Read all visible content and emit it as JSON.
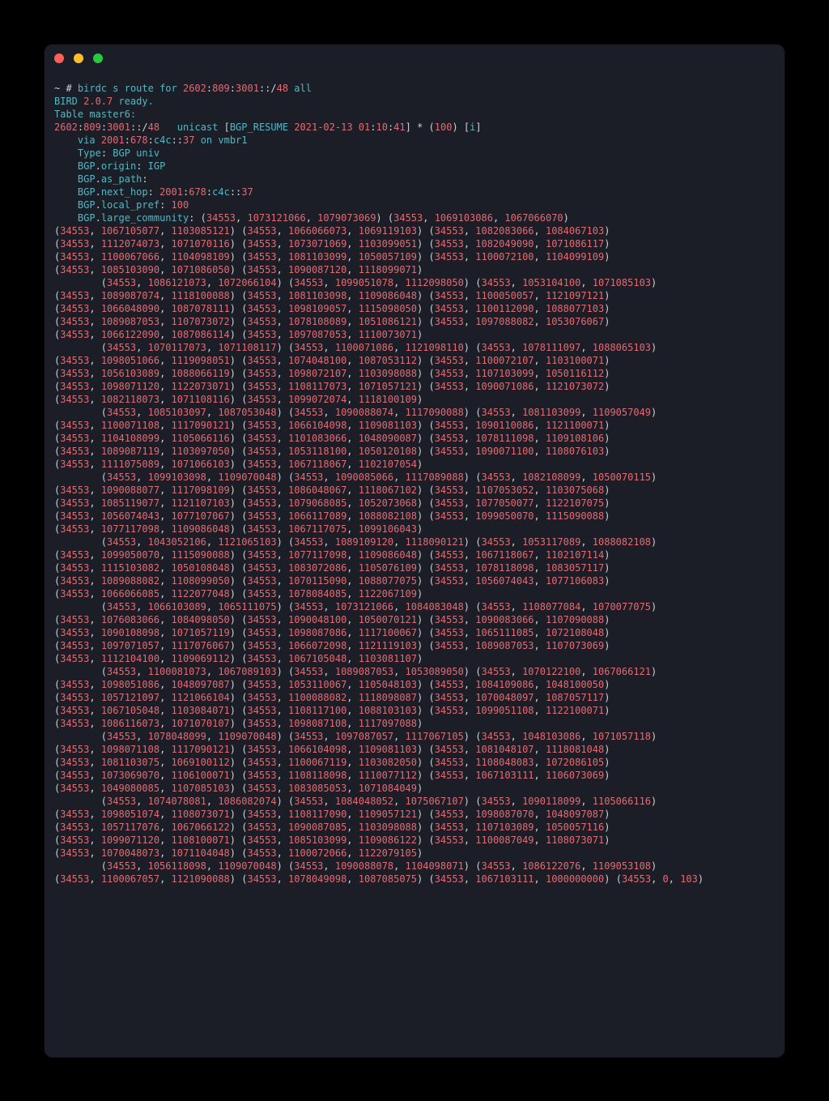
{
  "prompt_prefix": "~ # ",
  "cmd": {
    "w1": "birdc ",
    "w2": "s route ",
    "w3": "for ",
    "addr": "2602",
    "sep1": ":",
    "a2": "809",
    "sep2": ":",
    "a3": "3001",
    "sep3": "::/",
    "pre": "48",
    "tail": " all"
  },
  "line2": {
    "a": "BIRD ",
    "v": "2.0.7",
    "b": " ready."
  },
  "line3": "Table master6:",
  "line4": {
    "p1": "2602",
    "c": ":",
    "p2": "809",
    "p3": "3001",
    "tail": "::/",
    "pre": "48",
    "sp": "   ",
    "uni": "unicast ",
    "lb": "[",
    "name": "BGP_RESUME ",
    "d1": "2021-02-13",
    "sp2": " ",
    "t1": "01",
    "tc": ":",
    "t2": "10",
    "t3": "41",
    "rb": "]",
    "star": " * (",
    "hund": "100",
    "close": ") [",
    "i": "i",
    "end": "]"
  },
  "line5": {
    "a": "    via ",
    "v1": "2001",
    "c": ":",
    "v2": "678",
    "v3": "c4c",
    "v4": "::",
    "v5": "37",
    "on": " on vmbr1"
  },
  "line6": {
    "ind": "    ",
    "t": "Type",
    "colon": ": ",
    "v": "BGP univ"
  },
  "line7": {
    "ind": "    ",
    "b": "BGP",
    ".": ".",
    "k": "origin",
    ":": ": ",
    "v": "IGP"
  },
  "line8": {
    "ind": "    ",
    "b": "BGP",
    ".": ".",
    "k": "as_path",
    ":": ":"
  },
  "line9": {
    "ind": "    ",
    "b": "BGP",
    ".": ".",
    "k": "next_hop",
    ":": ": ",
    "v1": "2001",
    "c": ":",
    "v2": "678",
    "v3": "c4c",
    "v4": "::",
    "v5": "37"
  },
  "line10": {
    "ind": "    ",
    "b": "BGP",
    ".": ".",
    "k": "local_pref",
    ":": ": ",
    "v": "100"
  },
  "line11": {
    "ind": "    ",
    "b": "BGP",
    ".": ".",
    "k": "large_community",
    ":": ": "
  },
  "blocks": [
    {
      "lead_label": true,
      "rows": [
        [
          [
            34553,
            1073121066,
            1079073069
          ],
          [
            34553,
            1069103086,
            1067066070
          ],
          [
            34553,
            1067105077,
            1103085121
          ],
          [
            34553,
            1066066073,
            1069119103
          ],
          [
            34553,
            1082083066,
            1084067103
          ],
          [
            34553,
            1112074073,
            1071070116
          ],
          [
            34553,
            1073071069,
            1103099051
          ],
          [
            34553,
            1082049090,
            1071086117
          ],
          [
            34553,
            1100067066,
            1104098109
          ],
          [
            34553,
            1081103099,
            1050057109
          ],
          [
            34553,
            1100072100,
            1104099109
          ],
          [
            34553,
            1085103090,
            1071086050
          ],
          [
            34553,
            1090087120,
            1118099071
          ]
        ]
      ]
    },
    {
      "rows": [
        [
          [
            34553,
            1086121073,
            1072066104
          ],
          [
            34553,
            1099051078,
            1112098050
          ],
          [
            34553,
            1053104100,
            1071085103
          ],
          [
            34553,
            1089087074,
            1118100088
          ],
          [
            34553,
            1081103098,
            1109086048
          ],
          [
            34553,
            1100050057,
            1121097121
          ],
          [
            34553,
            1066048090,
            1087078111
          ],
          [
            34553,
            1098109057,
            1115098050
          ],
          [
            34553,
            1100112090,
            1088077103
          ],
          [
            34553,
            1089087053,
            1107073072
          ],
          [
            34553,
            1078108089,
            1051086121
          ],
          [
            34553,
            1097088082,
            1053076067
          ],
          [
            34553,
            1066122090,
            1087086114
          ],
          [
            34553,
            1097087053,
            1110073071
          ]
        ]
      ]
    },
    {
      "rows": [
        [
          [
            34553,
            1070117073,
            1071108117
          ],
          [
            34553,
            1100071086,
            1121098110
          ],
          [
            34553,
            1078111097,
            1088065103
          ],
          [
            34553,
            1098051066,
            1119098051
          ],
          [
            34553,
            1074048100,
            1087053112
          ],
          [
            34553,
            1100072107,
            1103100071
          ],
          [
            34553,
            1056103089,
            1088066119
          ],
          [
            34553,
            1098072107,
            1103098088
          ],
          [
            34553,
            1107103099,
            1050116112
          ],
          [
            34553,
            1098071120,
            1122073071
          ],
          [
            34553,
            1108117073,
            1071057121
          ],
          [
            34553,
            1090071086,
            1121073072
          ],
          [
            34553,
            1082118073,
            1071108116
          ],
          [
            34553,
            1099072074,
            1118100109
          ]
        ]
      ]
    },
    {
      "rows": [
        [
          [
            34553,
            1085103097,
            1087053048
          ],
          [
            34553,
            1090088074,
            1117090088
          ],
          [
            34553,
            1081103099,
            1109057049
          ],
          [
            34553,
            1100071108,
            1117090121
          ],
          [
            34553,
            1066104098,
            1109081103
          ],
          [
            34553,
            1090110086,
            1121100071
          ],
          [
            34553,
            1104108099,
            1105066116
          ],
          [
            34553,
            1101083066,
            1048090087
          ],
          [
            34553,
            1078111098,
            1109108106
          ],
          [
            34553,
            1089087119,
            1103097050
          ],
          [
            34553,
            1053118100,
            1050120108
          ],
          [
            34553,
            1090071100,
            1108076103
          ],
          [
            34553,
            1111075089,
            1071066103
          ],
          [
            34553,
            1067118067,
            1102107054
          ]
        ]
      ]
    },
    {
      "rows": [
        [
          [
            34553,
            1099103098,
            1109070048
          ],
          [
            34553,
            1090085066,
            1117089088
          ],
          [
            34553,
            1082108099,
            1050070115
          ],
          [
            34553,
            1090088077,
            1117098109
          ],
          [
            34553,
            1086048067,
            1118067102
          ],
          [
            34553,
            1107053052,
            1103075068
          ],
          [
            34553,
            1085119077,
            1121107103
          ],
          [
            34553,
            1079068085,
            1052073068
          ],
          [
            34553,
            1077050077,
            1122107075
          ],
          [
            34553,
            1056074043,
            1077107067
          ],
          [
            34553,
            1066117089,
            1088082108
          ],
          [
            34553,
            1099050070,
            1115090088
          ],
          [
            34553,
            1077117098,
            1109086048
          ],
          [
            34553,
            1067117075,
            1099106043
          ]
        ]
      ]
    },
    {
      "rows": [
        [
          [
            34553,
            1043052106,
            1121065103
          ],
          [
            34553,
            1089109120,
            1118090121
          ],
          [
            34553,
            1053117089,
            1088082108
          ],
          [
            34553,
            1099050070,
            1115090088
          ],
          [
            34553,
            1077117098,
            1109086048
          ],
          [
            34553,
            1067118067,
            1102107114
          ],
          [
            34553,
            1115103082,
            1050108048
          ],
          [
            34553,
            1083072086,
            1105076109
          ],
          [
            34553,
            1078118098,
            1083057117
          ],
          [
            34553,
            1089088082,
            1108099050
          ],
          [
            34553,
            1070115090,
            1088077075
          ],
          [
            34553,
            1056074043,
            1077106083
          ],
          [
            34553,
            1066066085,
            1122077048
          ],
          [
            34553,
            1078084085,
            1122067109
          ]
        ]
      ]
    },
    {
      "rows": [
        [
          [
            34553,
            1066103089,
            1065111075
          ],
          [
            34553,
            1073121066,
            1084083048
          ],
          [
            34553,
            1108077084,
            1070077075
          ],
          [
            34553,
            1076083066,
            1084098050
          ],
          [
            34553,
            1090048100,
            1050070121
          ],
          [
            34553,
            1090083066,
            1107090088
          ],
          [
            34553,
            1090108098,
            1071057119
          ],
          [
            34553,
            1098087086,
            1117100067
          ],
          [
            34553,
            1065111085,
            1072108048
          ],
          [
            34553,
            1097071057,
            1117076067
          ],
          [
            34553,
            1066072098,
            1121119103
          ],
          [
            34553,
            1089087053,
            1107073069
          ],
          [
            34553,
            1112104100,
            1109069112
          ],
          [
            34553,
            1067105048,
            1103081107
          ]
        ]
      ]
    },
    {
      "rows": [
        [
          [
            34553,
            1100081073,
            1067089103
          ],
          [
            34553,
            1089087053,
            1053089050
          ],
          [
            34553,
            1070122100,
            1067066121
          ],
          [
            34553,
            1098051086,
            1048097087
          ],
          [
            34553,
            1053110067,
            1105048103
          ],
          [
            34553,
            1084109086,
            1048100050
          ],
          [
            34553,
            1057121097,
            1121066104
          ],
          [
            34553,
            1100088082,
            1118098087
          ],
          [
            34553,
            1070048097,
            1087057117
          ],
          [
            34553,
            1067105048,
            1103084071
          ],
          [
            34553,
            1108117100,
            1088103103
          ],
          [
            34553,
            1099051108,
            1122100071
          ],
          [
            34553,
            1086116073,
            1071070107
          ],
          [
            34553,
            1098087108,
            1117097088
          ]
        ]
      ]
    },
    {
      "rows": [
        [
          [
            34553,
            1078048099,
            1109070048
          ],
          [
            34553,
            1097087057,
            1117067105
          ],
          [
            34553,
            1048103086,
            1071057118
          ],
          [
            34553,
            1098071108,
            1117090121
          ],
          [
            34553,
            1066104098,
            1109081103
          ],
          [
            34553,
            1081048107,
            1118081048
          ],
          [
            34553,
            1081103075,
            1069100112
          ],
          [
            34553,
            1100067119,
            1103082050
          ],
          [
            34553,
            1108048083,
            1072086105
          ],
          [
            34553,
            1073069070,
            1106100071
          ],
          [
            34553,
            1108118098,
            1110077112
          ],
          [
            34553,
            1067103111,
            1106073069
          ],
          [
            34553,
            1049080085,
            1107085103
          ],
          [
            34553,
            1083085053,
            1071084049
          ]
        ]
      ]
    },
    {
      "rows": [
        [
          [
            34553,
            1074078081,
            1086082074
          ],
          [
            34553,
            1084048052,
            1075067107
          ],
          [
            34553,
            1090118099,
            1105066116
          ],
          [
            34553,
            1098051074,
            1108073071
          ],
          [
            34553,
            1108117090,
            1109057121
          ],
          [
            34553,
            1098087070,
            1048097087
          ],
          [
            34553,
            1057117076,
            1067066122
          ],
          [
            34553,
            1090087085,
            1103098088
          ],
          [
            34553,
            1107103089,
            1050057116
          ],
          [
            34553,
            1099071120,
            1108100071
          ],
          [
            34553,
            1085103099,
            1109086122
          ],
          [
            34553,
            1100087049,
            1108073071
          ],
          [
            34553,
            1070048073,
            1071104048
          ],
          [
            34553,
            1100072066,
            1122079105
          ]
        ]
      ]
    },
    {
      "rows": [
        [
          [
            34553,
            1056118098,
            1109070048
          ],
          [
            34553,
            1090088078,
            1104098071
          ],
          [
            34553,
            1086122076,
            1109053108
          ],
          [
            34553,
            1100067057,
            1121090088
          ],
          [
            34553,
            1078049098,
            1087085075
          ],
          [
            34553,
            1067103111,
            1000000000
          ],
          [
            34553,
            0,
            103
          ]
        ]
      ]
    }
  ]
}
